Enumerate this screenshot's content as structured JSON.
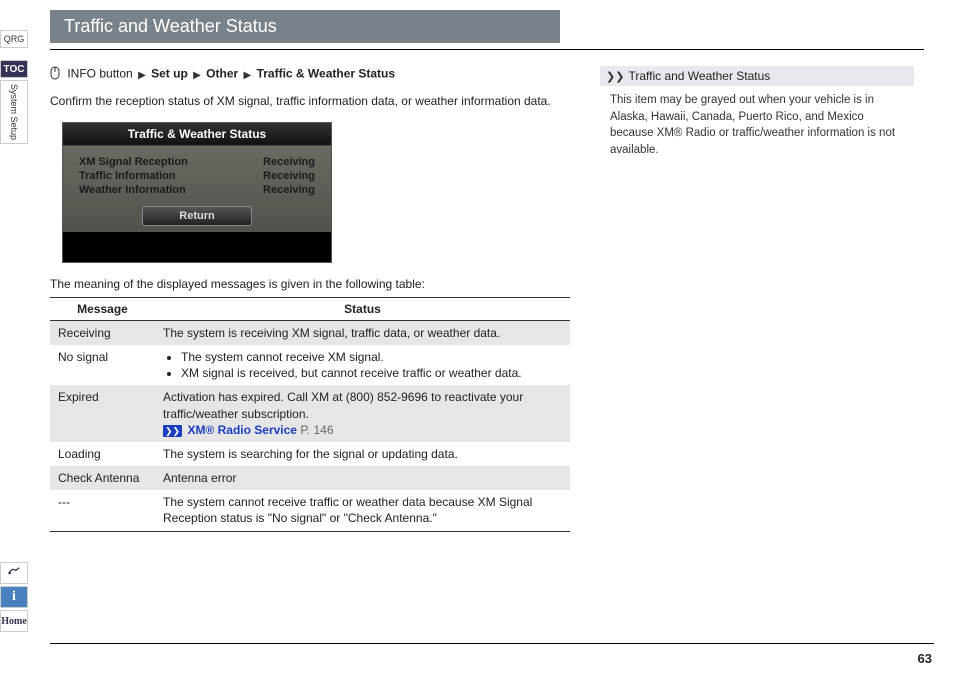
{
  "gutter": {
    "qrg": "QRG",
    "toc": "TOC",
    "section": "System Setup",
    "home": "Home"
  },
  "title": "Traffic and Weather Status",
  "breadcrumb": {
    "info_button": "INFO button",
    "setup": "Set up",
    "other": "Other",
    "item": "Traffic & Weather Status"
  },
  "intro": "Confirm the reception status of XM signal, traffic information data, or weather information data.",
  "device": {
    "title": "Traffic & Weather Status",
    "rows": [
      {
        "label": "XM Signal Reception",
        "value": "Receiving"
      },
      {
        "label": "Traffic Information",
        "value": "Receiving"
      },
      {
        "label": "Weather Information",
        "value": "Receiving"
      }
    ],
    "return_label": "Return"
  },
  "table_intro": "The meaning of the displayed messages is given in the following table:",
  "table": {
    "headers": {
      "message": "Message",
      "status": "Status"
    },
    "rows": [
      {
        "shade": true,
        "message": "Receiving",
        "status_text": "The system is receiving XM signal, traffic data, or weather data."
      },
      {
        "shade": false,
        "message": "No signal",
        "status_bullets": [
          "The system cannot receive XM signal.",
          "XM signal is received, but cannot receive traffic or weather data."
        ]
      },
      {
        "shade": true,
        "message": "Expired",
        "status_text": "Activation has expired. Call XM at (800) 852-9696 to reactivate your traffic/weather subscription.",
        "xref": {
          "label": "XM® Radio Service",
          "page_prefix": "P.",
          "page": "146"
        }
      },
      {
        "shade": false,
        "message": "Loading",
        "status_text": "The system is searching for the signal or updating data."
      },
      {
        "shade": true,
        "message": "Check Antenna",
        "status_text": "Antenna error"
      },
      {
        "shade": false,
        "message": "---",
        "status_text": "The system cannot receive traffic or weather data because XM Signal Reception status is \"No signal\" or \"Check Antenna.\""
      }
    ]
  },
  "sidebar": {
    "note_title": "Traffic and Weather Status",
    "note_body": "This item may be grayed out when your vehicle is in Alaska, Hawaii, Canada, Puerto Rico, and Mexico because XM® Radio or traffic/weather information is not available."
  },
  "page_number": "63"
}
